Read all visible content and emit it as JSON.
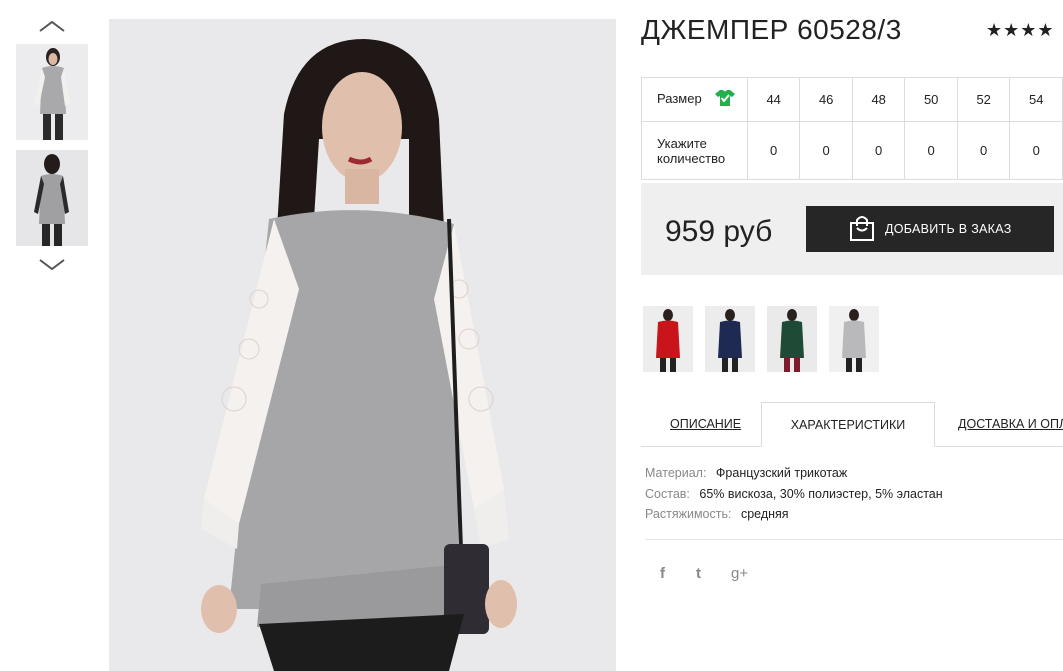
{
  "product": {
    "title": "ДЖЕМПЕР 60528/3",
    "rating_stars": "★★★★",
    "rating_value": 4
  },
  "gallery": {
    "thumbnails": [
      "thumb-front",
      "thumb-back"
    ],
    "up_icon": "chevron-up-icon",
    "down_icon": "chevron-down-icon"
  },
  "size_table": {
    "size_label": "Размер",
    "size_icon": "shirt-check-icon",
    "qty_label_line1": "Укажите",
    "qty_label_line2": "количество",
    "sizes": [
      "44",
      "46",
      "48",
      "50",
      "52",
      "54"
    ],
    "quantities": [
      "0",
      "0",
      "0",
      "0",
      "0",
      "0"
    ]
  },
  "purchase": {
    "price": "959 руб",
    "add_button": "ДОБАВИТЬ В ЗАКАЗ",
    "bag_icon": "shopping-bag-icon"
  },
  "colors": [
    {
      "name": "red",
      "hex": "#c9141c"
    },
    {
      "name": "navy",
      "hex": "#1e2a52"
    },
    {
      "name": "green",
      "hex": "#1f4a35"
    },
    {
      "name": "grey",
      "hex": "#b9b9bb"
    }
  ],
  "tabs": {
    "description": "ОПИСАНИЕ",
    "characteristics": "ХАРАКТЕРИСТИКИ",
    "delivery": "ДОСТАВКА И ОПЛ"
  },
  "specs": {
    "material_key": "Материал:",
    "material_val": "Французский трикотаж",
    "composition_key": "Состав:",
    "composition_val": "65% вискоза, 30% полиэстер, 5% эластан",
    "stretch_key": "Растяжимость:",
    "stretch_val": "средняя"
  },
  "social": {
    "facebook": "f",
    "twitter": "t",
    "google": "g+"
  }
}
